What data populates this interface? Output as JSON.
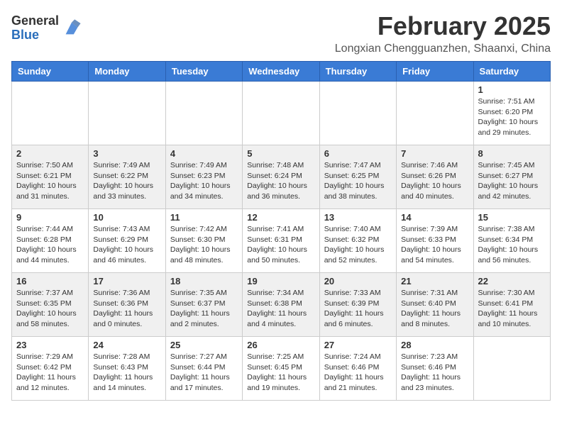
{
  "header": {
    "logo_line1": "General",
    "logo_line2": "Blue",
    "month": "February 2025",
    "location": "Longxian Chengguanzhen, Shaanxi, China"
  },
  "weekdays": [
    "Sunday",
    "Monday",
    "Tuesday",
    "Wednesday",
    "Thursday",
    "Friday",
    "Saturday"
  ],
  "weeks": [
    [
      {
        "day": "",
        "info": ""
      },
      {
        "day": "",
        "info": ""
      },
      {
        "day": "",
        "info": ""
      },
      {
        "day": "",
        "info": ""
      },
      {
        "day": "",
        "info": ""
      },
      {
        "day": "",
        "info": ""
      },
      {
        "day": "1",
        "info": "Sunrise: 7:51 AM\nSunset: 6:20 PM\nDaylight: 10 hours\nand 29 minutes."
      }
    ],
    [
      {
        "day": "2",
        "info": "Sunrise: 7:50 AM\nSunset: 6:21 PM\nDaylight: 10 hours\nand 31 minutes."
      },
      {
        "day": "3",
        "info": "Sunrise: 7:49 AM\nSunset: 6:22 PM\nDaylight: 10 hours\nand 33 minutes."
      },
      {
        "day": "4",
        "info": "Sunrise: 7:49 AM\nSunset: 6:23 PM\nDaylight: 10 hours\nand 34 minutes."
      },
      {
        "day": "5",
        "info": "Sunrise: 7:48 AM\nSunset: 6:24 PM\nDaylight: 10 hours\nand 36 minutes."
      },
      {
        "day": "6",
        "info": "Sunrise: 7:47 AM\nSunset: 6:25 PM\nDaylight: 10 hours\nand 38 minutes."
      },
      {
        "day": "7",
        "info": "Sunrise: 7:46 AM\nSunset: 6:26 PM\nDaylight: 10 hours\nand 40 minutes."
      },
      {
        "day": "8",
        "info": "Sunrise: 7:45 AM\nSunset: 6:27 PM\nDaylight: 10 hours\nand 42 minutes."
      }
    ],
    [
      {
        "day": "9",
        "info": "Sunrise: 7:44 AM\nSunset: 6:28 PM\nDaylight: 10 hours\nand 44 minutes."
      },
      {
        "day": "10",
        "info": "Sunrise: 7:43 AM\nSunset: 6:29 PM\nDaylight: 10 hours\nand 46 minutes."
      },
      {
        "day": "11",
        "info": "Sunrise: 7:42 AM\nSunset: 6:30 PM\nDaylight: 10 hours\nand 48 minutes."
      },
      {
        "day": "12",
        "info": "Sunrise: 7:41 AM\nSunset: 6:31 PM\nDaylight: 10 hours\nand 50 minutes."
      },
      {
        "day": "13",
        "info": "Sunrise: 7:40 AM\nSunset: 6:32 PM\nDaylight: 10 hours\nand 52 minutes."
      },
      {
        "day": "14",
        "info": "Sunrise: 7:39 AM\nSunset: 6:33 PM\nDaylight: 10 hours\nand 54 minutes."
      },
      {
        "day": "15",
        "info": "Sunrise: 7:38 AM\nSunset: 6:34 PM\nDaylight: 10 hours\nand 56 minutes."
      }
    ],
    [
      {
        "day": "16",
        "info": "Sunrise: 7:37 AM\nSunset: 6:35 PM\nDaylight: 10 hours\nand 58 minutes."
      },
      {
        "day": "17",
        "info": "Sunrise: 7:36 AM\nSunset: 6:36 PM\nDaylight: 11 hours\nand 0 minutes."
      },
      {
        "day": "18",
        "info": "Sunrise: 7:35 AM\nSunset: 6:37 PM\nDaylight: 11 hours\nand 2 minutes."
      },
      {
        "day": "19",
        "info": "Sunrise: 7:34 AM\nSunset: 6:38 PM\nDaylight: 11 hours\nand 4 minutes."
      },
      {
        "day": "20",
        "info": "Sunrise: 7:33 AM\nSunset: 6:39 PM\nDaylight: 11 hours\nand 6 minutes."
      },
      {
        "day": "21",
        "info": "Sunrise: 7:31 AM\nSunset: 6:40 PM\nDaylight: 11 hours\nand 8 minutes."
      },
      {
        "day": "22",
        "info": "Sunrise: 7:30 AM\nSunset: 6:41 PM\nDaylight: 11 hours\nand 10 minutes."
      }
    ],
    [
      {
        "day": "23",
        "info": "Sunrise: 7:29 AM\nSunset: 6:42 PM\nDaylight: 11 hours\nand 12 minutes."
      },
      {
        "day": "24",
        "info": "Sunrise: 7:28 AM\nSunset: 6:43 PM\nDaylight: 11 hours\nand 14 minutes."
      },
      {
        "day": "25",
        "info": "Sunrise: 7:27 AM\nSunset: 6:44 PM\nDaylight: 11 hours\nand 17 minutes."
      },
      {
        "day": "26",
        "info": "Sunrise: 7:25 AM\nSunset: 6:45 PM\nDaylight: 11 hours\nand 19 minutes."
      },
      {
        "day": "27",
        "info": "Sunrise: 7:24 AM\nSunset: 6:46 PM\nDaylight: 11 hours\nand 21 minutes."
      },
      {
        "day": "28",
        "info": "Sunrise: 7:23 AM\nSunset: 6:46 PM\nDaylight: 11 hours\nand 23 minutes."
      },
      {
        "day": "",
        "info": ""
      }
    ]
  ]
}
